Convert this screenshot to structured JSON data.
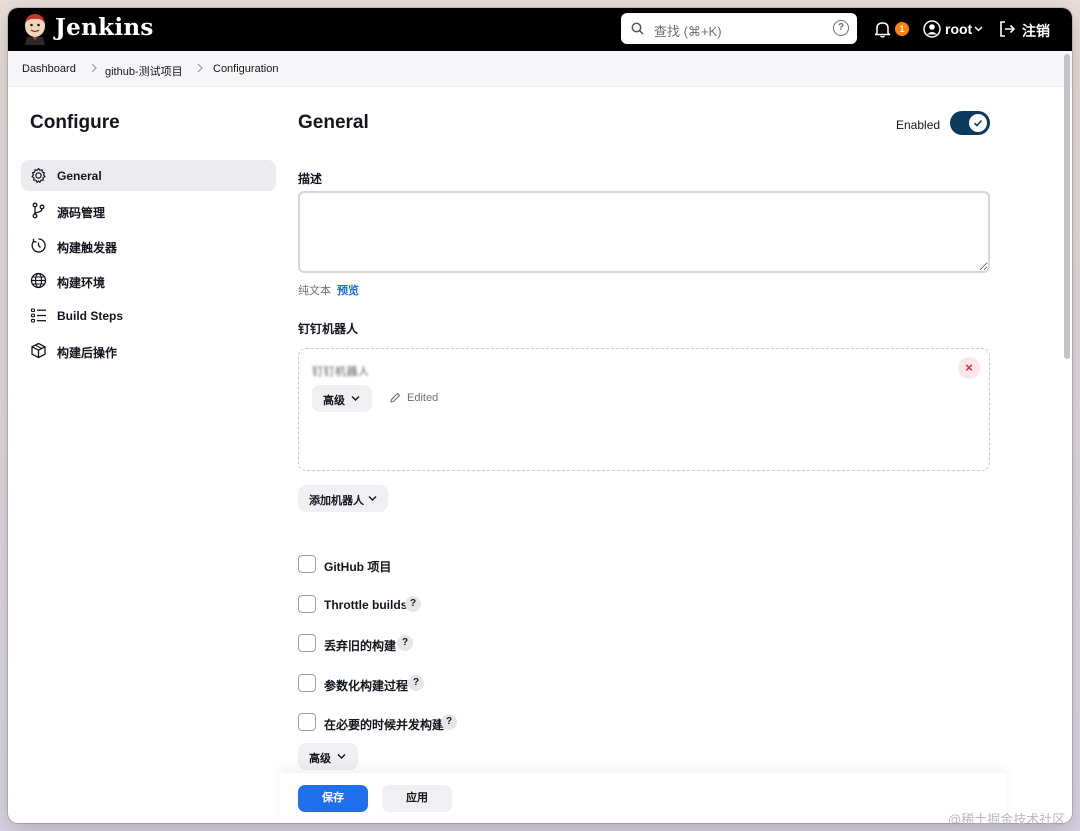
{
  "header": {
    "brand": "Jenkins",
    "search_placeholder": "查找 (⌘+K)",
    "help_glyph": "?",
    "notification_count": "1",
    "user": "root",
    "logout": "注销"
  },
  "breadcrumb": [
    "Dashboard",
    "github-测试项目",
    "Configuration"
  ],
  "sidebar": {
    "title": "Configure",
    "items": [
      {
        "label": "General",
        "icon": "gear-icon",
        "active": true
      },
      {
        "label": "源码管理",
        "icon": "branch-icon"
      },
      {
        "label": "构建触发器",
        "icon": "timer-icon"
      },
      {
        "label": "构建环境",
        "icon": "globe-icon"
      },
      {
        "label": "Build Steps",
        "icon": "list-icon"
      },
      {
        "label": "构建后操作",
        "icon": "package-icon"
      }
    ]
  },
  "main": {
    "title": "General",
    "enabled_label": "Enabled",
    "enabled": true,
    "description_label": "描述",
    "description_value": "",
    "plain_text": "纯文本",
    "preview": "预览",
    "robot_section_label": "钉钉机器人",
    "robot_name": "钉钉机器人",
    "robot_close": "×",
    "robot_advanced": "高级",
    "robot_edited": "Edited",
    "add_robot": "添加机器人",
    "checkboxes": [
      {
        "label": "GitHub 项目",
        "help": false
      },
      {
        "label": "Throttle builds",
        "help": true
      },
      {
        "label": "丢弃旧的构建",
        "help": true
      },
      {
        "label": "参数化构建过程",
        "help": true
      },
      {
        "label": "在必要的时候并发构建",
        "help": true
      }
    ],
    "help_glyph": "?",
    "advanced": "高级"
  },
  "footer": {
    "save": "保存",
    "apply": "应用"
  },
  "watermark": "@稀土掘金技术社区",
  "colors": {
    "header_bg": "#000000",
    "primary": "#1f6feb",
    "toggle_on": "#0b3a5c",
    "badge": "#fe820a",
    "danger": "#e5253d"
  }
}
